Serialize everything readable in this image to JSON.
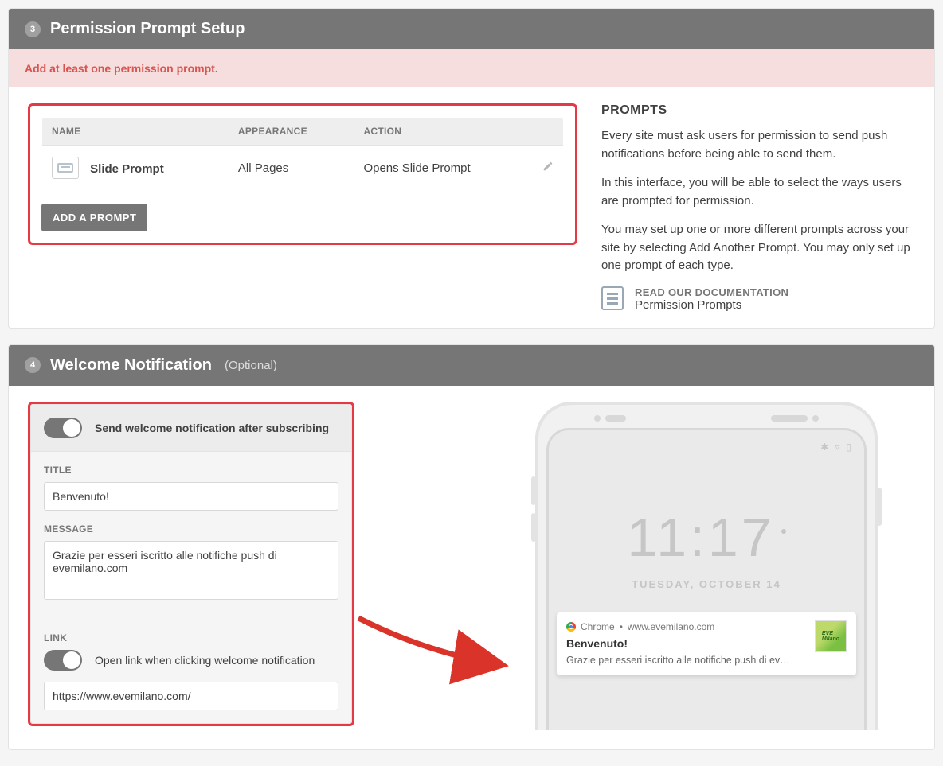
{
  "section3": {
    "num": "3",
    "title": "Permission Prompt Setup",
    "error": "Add at least one permission prompt.",
    "table": {
      "headers": {
        "name": "NAME",
        "appearance": "APPEARANCE",
        "action": "ACTION"
      },
      "rows": [
        {
          "name": "Slide Prompt",
          "appearance": "All Pages",
          "action": "Opens Slide Prompt"
        }
      ]
    },
    "add_btn": "ADD A PROMPT",
    "side": {
      "heading": "PROMPTS",
      "p1": "Every site must ask users for permission to send push notifications before being able to send them.",
      "p2": "In this interface, you will be able to select the ways users are prompted for permission.",
      "p3": "You may set up one or more different prompts across your site by selecting Add Another Prompt. You may only set up one prompt of each type.",
      "doc_h": "READ OUR DOCUMENTATION",
      "doc_link": "Permission Prompts"
    }
  },
  "section4": {
    "num": "4",
    "title": "Welcome Notification",
    "optional": "(Optional)",
    "toggle_send_label": "Send welcome notification after subscribing",
    "title_label": "TITLE",
    "title_value": "Benvenuto!",
    "message_label": "MESSAGE",
    "message_value": "Grazie per esseri iscritto alle notifiche push di evemilano.com",
    "link_label": "LINK",
    "toggle_link_label": "Open link when clicking welcome notification",
    "link_value": "https://www.evemilano.com/",
    "preview": {
      "clock": "11:17",
      "date": "TUESDAY, OCTOBER 14",
      "browser": "Chrome",
      "domain": "www.evemilano.com",
      "notif_title": "Benvenuto!",
      "notif_msg": "Grazie per esseri iscritto alle notifiche push di ev…"
    }
  }
}
